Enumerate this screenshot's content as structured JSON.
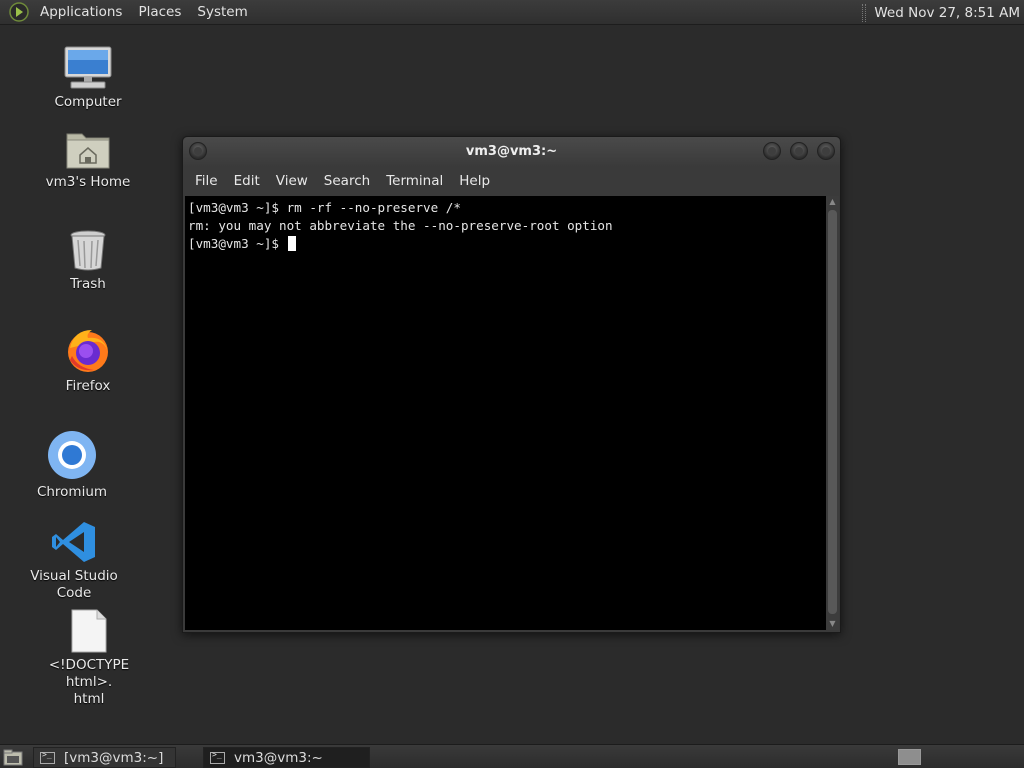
{
  "top_panel": {
    "menus": [
      "Applications",
      "Places",
      "System"
    ],
    "clock": "Wed Nov 27,  8:51 AM"
  },
  "desktop_icons": [
    {
      "label": "Computer",
      "icon": "computer-icon"
    },
    {
      "label": "vm3's Home",
      "icon": "home-folder-icon"
    },
    {
      "label": "Trash",
      "icon": "trash-icon"
    },
    {
      "label": "Firefox",
      "icon": "firefox-icon"
    },
    {
      "label": "Chromium",
      "icon": "chromium-icon"
    },
    {
      "label": "Visual Studio Code",
      "icon": "vscode-icon"
    },
    {
      "label": "<!DOCTYPE html>.\nhtml",
      "icon": "document-icon"
    }
  ],
  "terminal": {
    "title": "vm3@vm3:~",
    "menu": [
      "File",
      "Edit",
      "View",
      "Search",
      "Terminal",
      "Help"
    ],
    "lines": [
      "[vm3@vm3 ~]$ rm -rf --no-preserve /*",
      "rm: you may not abbreviate the --no-preserve-root option",
      "[vm3@vm3 ~]$ "
    ]
  },
  "taskbar": {
    "tasks": [
      {
        "label": "[vm3@vm3:~]",
        "active": false
      },
      {
        "label": "vm3@vm3:~",
        "active": true
      }
    ]
  },
  "colors": {
    "desktop_bg": "#2b2b2b",
    "terminal_bg": "#000000",
    "terminal_fg": "#e6e6e6",
    "vscode_blue": "#2f8fe0",
    "chromium_blue": "#4a8ee0"
  }
}
